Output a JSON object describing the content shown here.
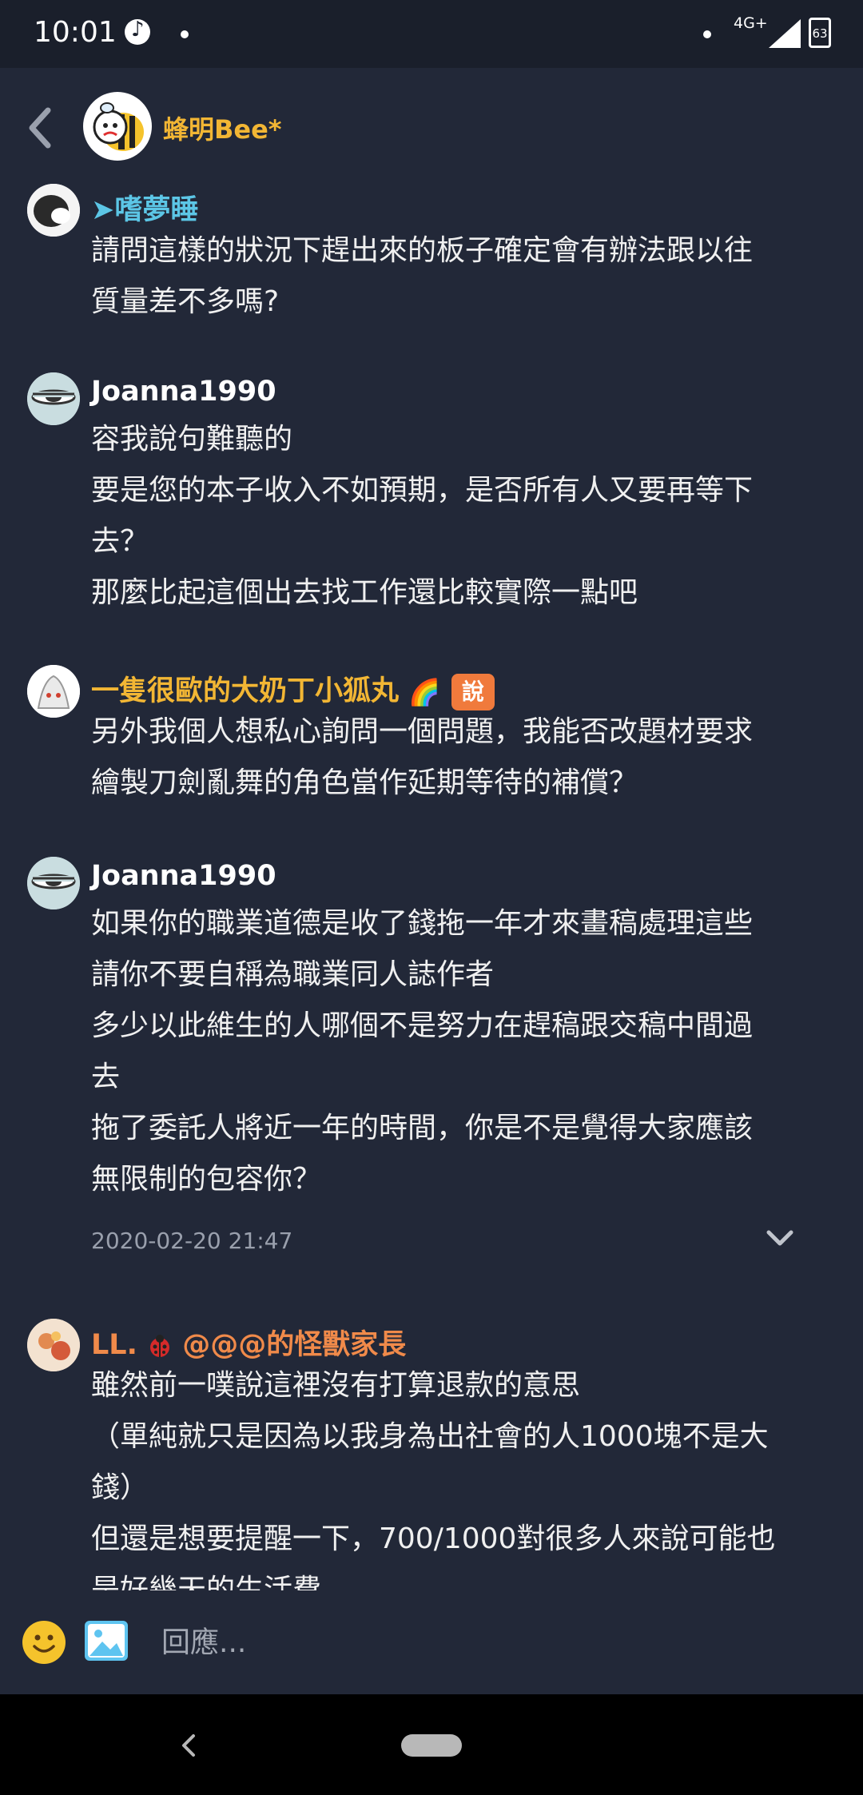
{
  "status_bar": {
    "time": "10:01",
    "network": "4G+",
    "battery": "63"
  },
  "header": {
    "title": "蜂明Bee*"
  },
  "messages": [
    {
      "author": "➤嗜夢睡",
      "author_color": "#5cc6e6",
      "lines": [
        "請問這樣的狀況下趕出來的板子確定會有辦法跟以往",
        "質量差不多嗎?"
      ]
    },
    {
      "author": "Joanna1990",
      "author_color": "#ffffff",
      "lines": [
        "容我說句難聽的",
        "要是您的本子收入不如預期，是否所有人又要再等下",
        "去？",
        "那麼比起這個出去找工作還比較實際一點吧"
      ]
    },
    {
      "author": "一隻很歐的大奶丁小狐丸",
      "author_color": "#f2b634",
      "emoji": "🌈",
      "badge": "說",
      "lines": [
        "另外我個人想私心詢問一個問題，我能否改題材要求",
        "繪製刀劍亂舞的角色當作延期等待的補償？"
      ]
    },
    {
      "author": "Joanna1990",
      "author_color": "#ffffff",
      "lines": [
        "如果你的職業道德是收了錢拖一年才來畫稿處理這些",
        "請你不要自稱為職業同人誌作者",
        "多少以此維生的人哪個不是努力在趕稿跟交稿中間過",
        "去",
        "拖了委託人將近一年的時間，你是不是覺得大家應該",
        "無限制的包容你？"
      ],
      "timestamp": "2020-02-20 21:47"
    },
    {
      "author_prefix": "LL.",
      "author_suffix": "@@@的怪獸家長",
      "author_color": "#f08a4a",
      "lines": [
        "雖然前一噗說這裡沒有打算退款的意思",
        "（單純就只是因為以我身為出社會的人1000塊不是大",
        "錢）",
        "但還是想要提醒一下，700/1000對很多人來說可能也",
        "是好幾天的生活費"
      ]
    }
  ],
  "reply": {
    "placeholder": "回應..."
  }
}
